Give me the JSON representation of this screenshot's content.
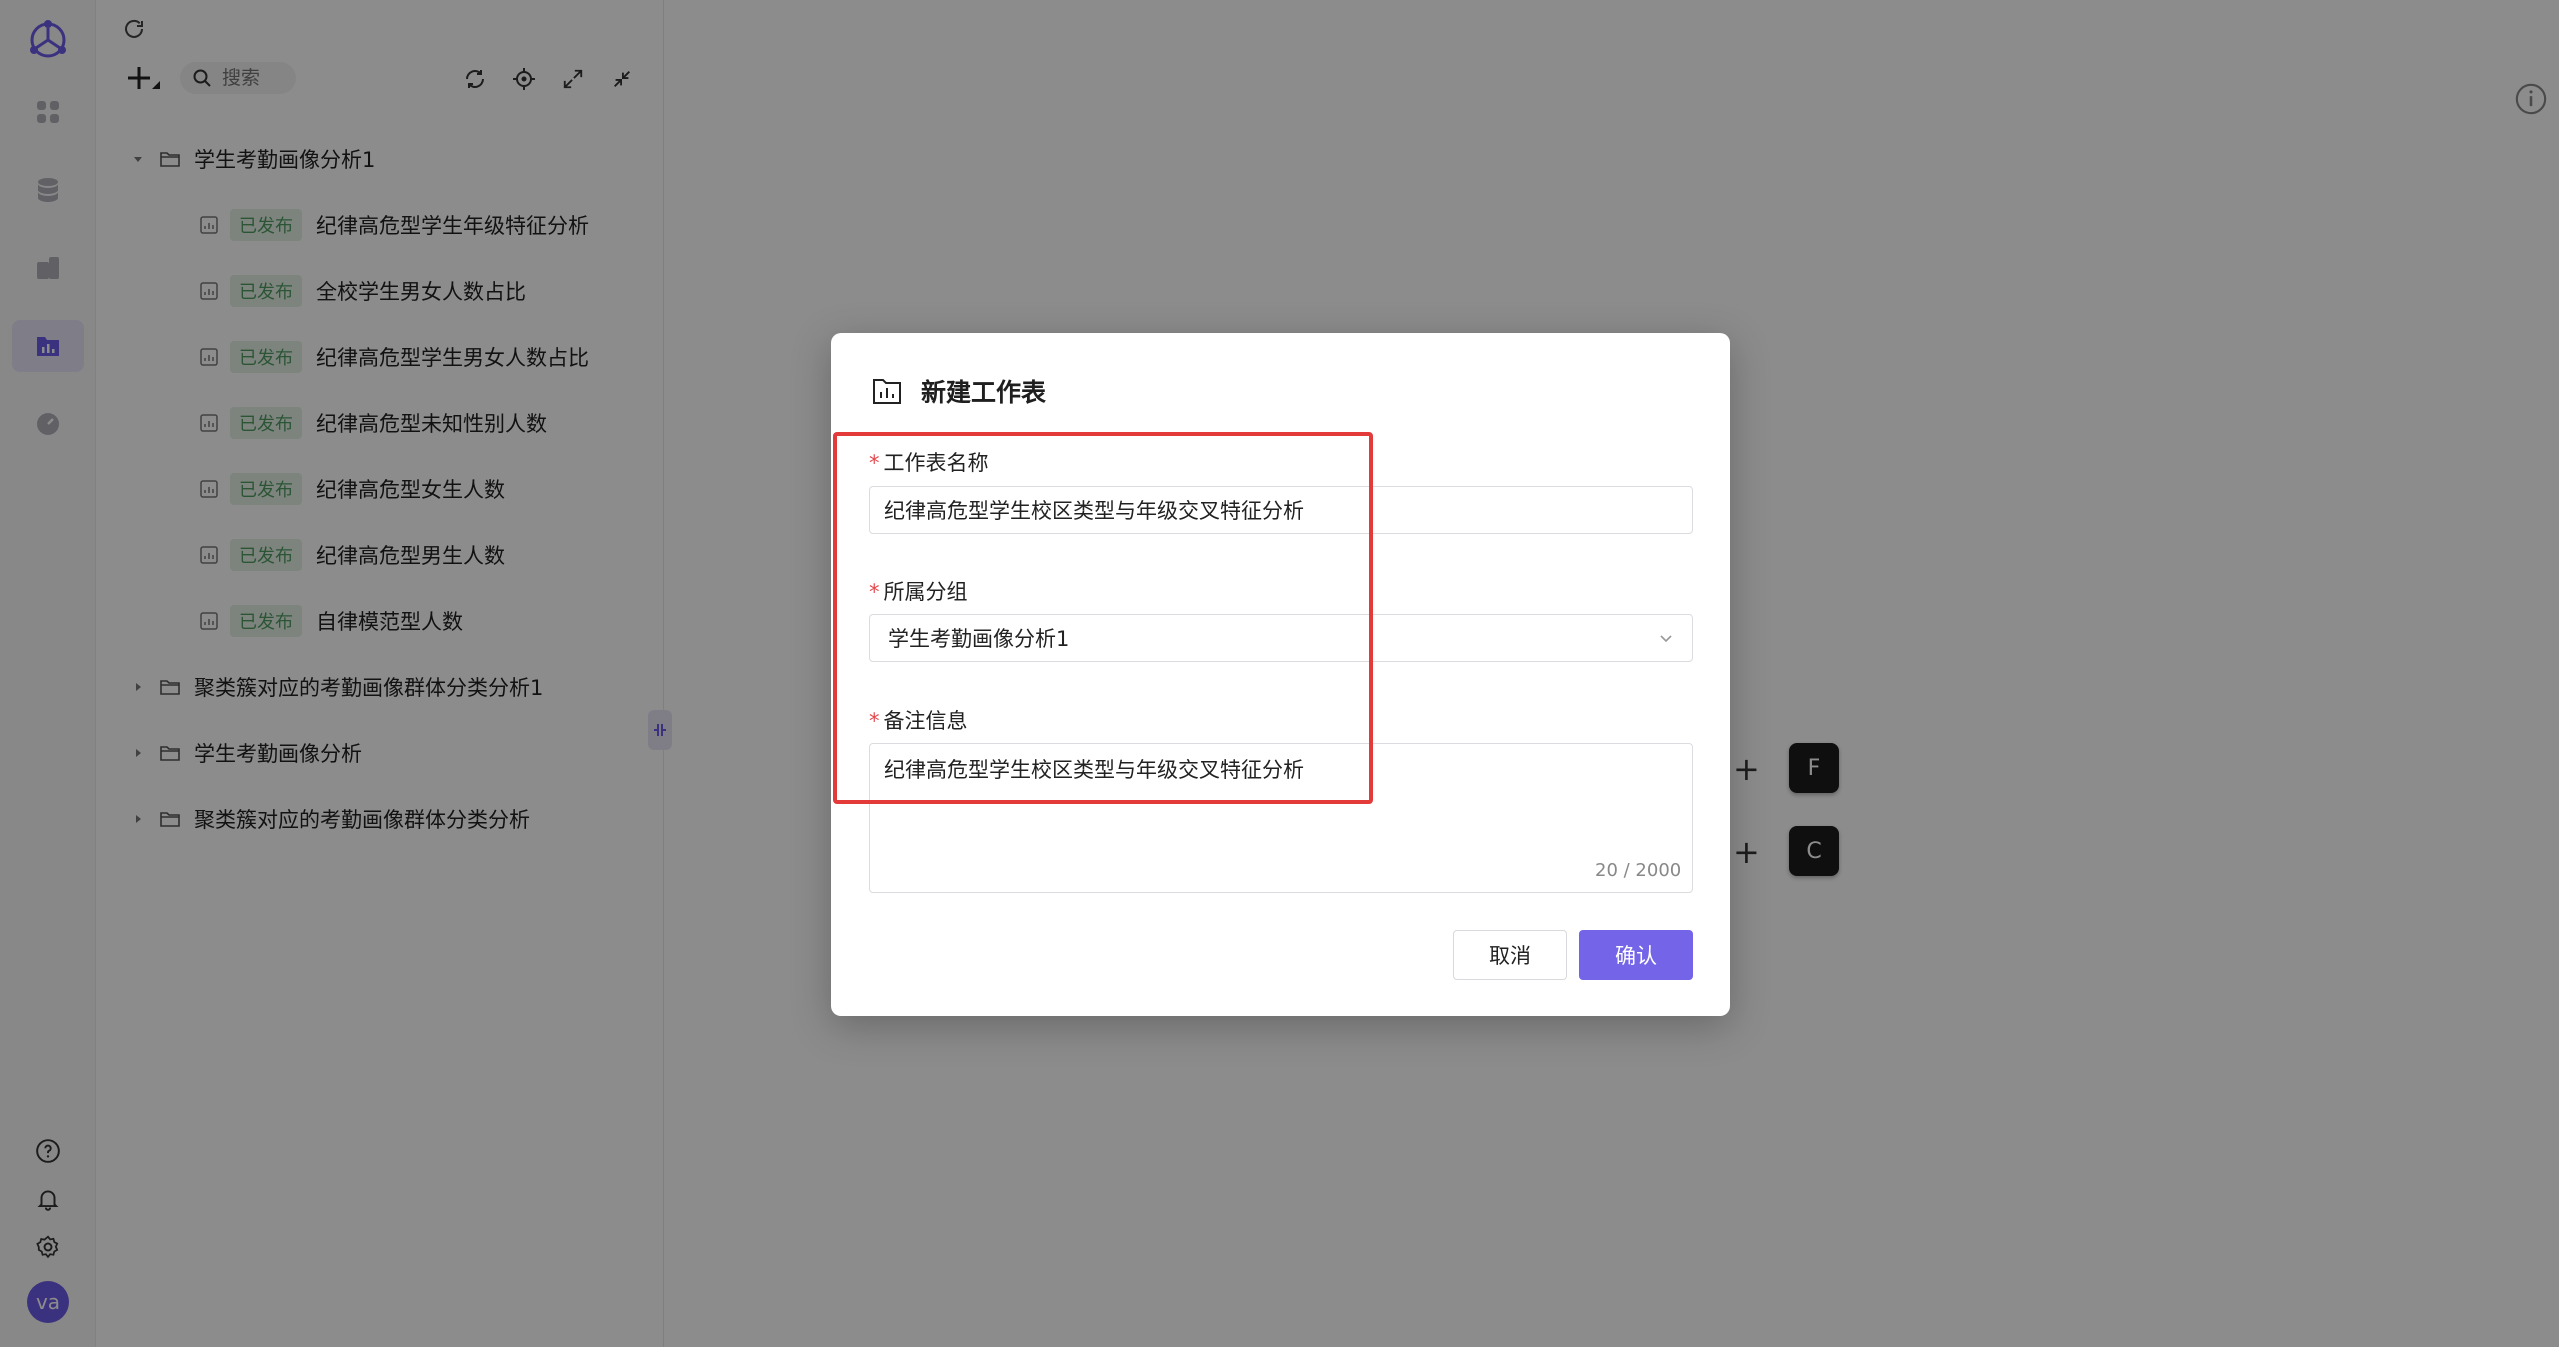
{
  "sidebar": {
    "user_initials": "va",
    "nav_icons": [
      "dashboard-icon",
      "database-icon",
      "report-icon",
      "worksheet-icon",
      "monitor-icon"
    ],
    "bottom_icons": [
      "help-icon",
      "bell-icon",
      "settings-icon"
    ]
  },
  "tree_toolbar": {
    "search_placeholder": "搜索"
  },
  "tree": {
    "groups": [
      {
        "name": "学生考勤画像分析1",
        "expanded": true,
        "items": [
          {
            "status": "已发布",
            "name": "纪律高危型学生年级特征分析"
          },
          {
            "status": "已发布",
            "name": "全校学生男女人数占比"
          },
          {
            "status": "已发布",
            "name": "纪律高危型学生男女人数占比"
          },
          {
            "status": "已发布",
            "name": "纪律高危型未知性别人数"
          },
          {
            "status": "已发布",
            "name": "纪律高危型女生人数"
          },
          {
            "status": "已发布",
            "name": "纪律高危型男生人数"
          },
          {
            "status": "已发布",
            "name": "自律模范型人数"
          }
        ]
      },
      {
        "name": "聚类簇对应的考勤画像群体分类分析1",
        "expanded": false
      },
      {
        "name": "学生考勤画像分析",
        "expanded": false
      },
      {
        "name": "聚类簇对应的考勤画像群体分类分析",
        "expanded": false
      }
    ]
  },
  "canvas": {
    "shortcut_keys": [
      "F",
      "C"
    ],
    "plus": "+"
  },
  "modal": {
    "title": "新建工作表",
    "name_label": "工作表名称",
    "name_value": "纪律高危型学生校区类型与年级交叉特征分析",
    "group_label": "所属分组",
    "group_value": "学生考勤画像分析1",
    "note_label": "备注信息",
    "note_value": "纪律高危型学生校区类型与年级交叉特征分析",
    "note_counter": "20 / 2000",
    "required_mark": "*",
    "cancel_label": "取消",
    "confirm_label": "确认",
    "accent_color": "#7364e8"
  }
}
